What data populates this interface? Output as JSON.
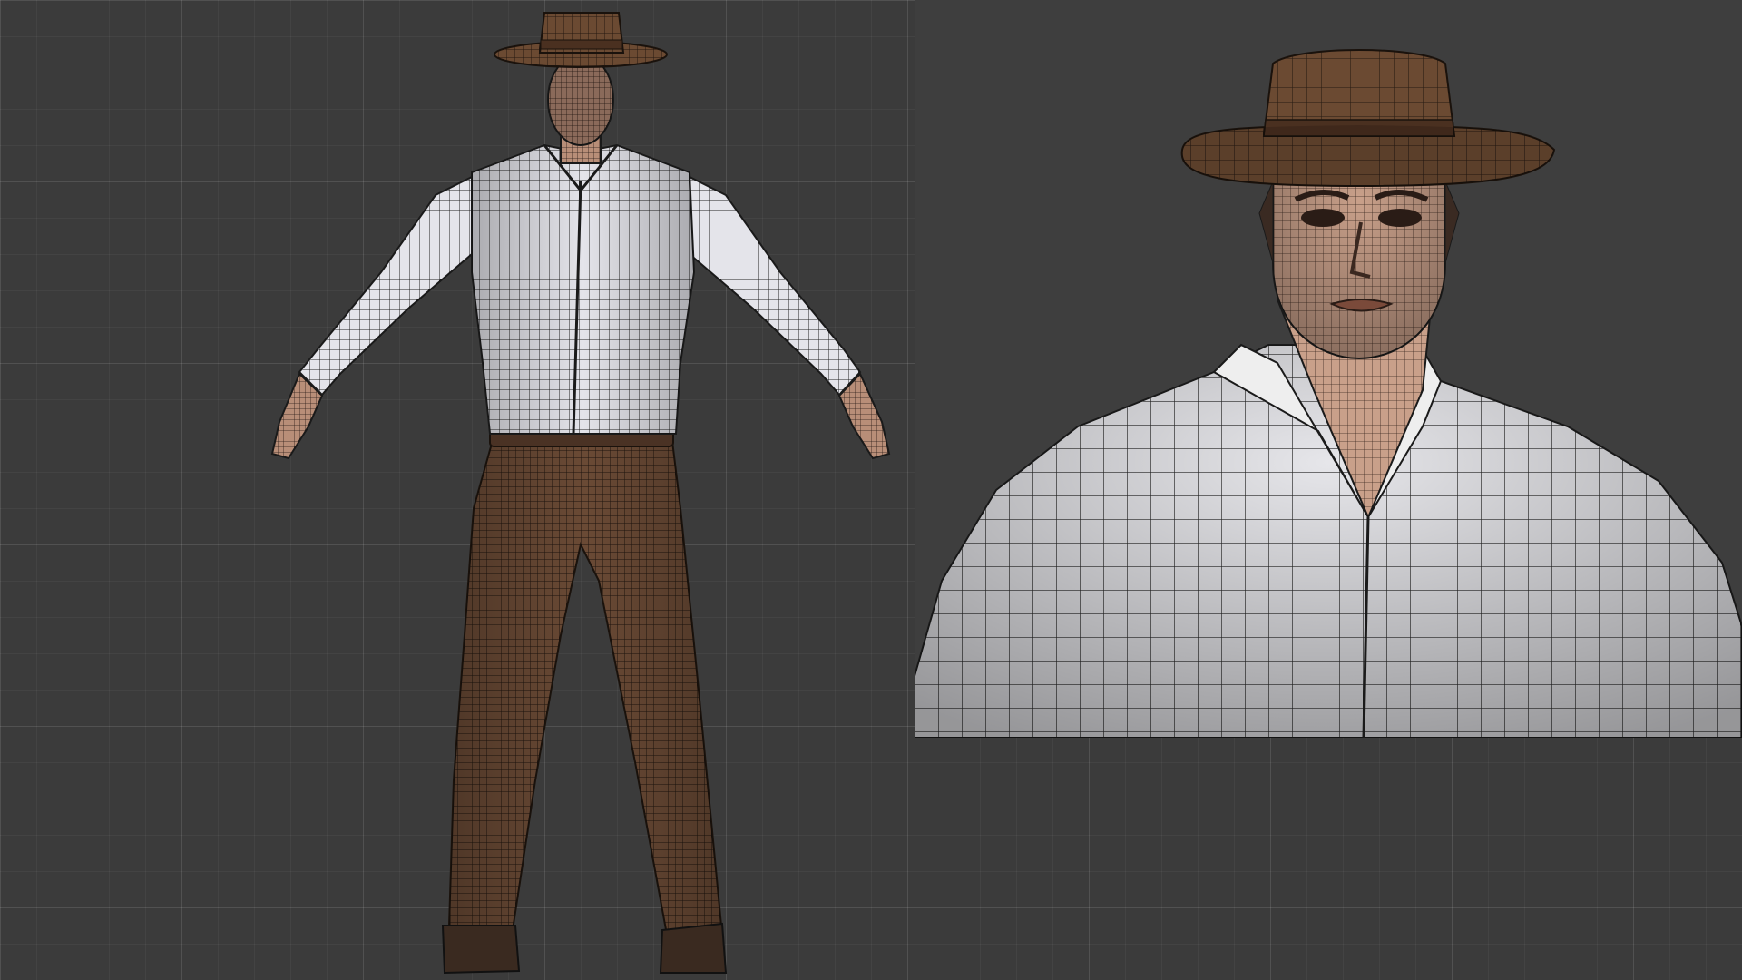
{
  "scene": {
    "background_color": "#3b3b3b",
    "grid_color": "#454545",
    "views": [
      {
        "name": "full-body-front-view",
        "subject": "character-t-pose-wireframe"
      },
      {
        "name": "closeup-head-torso-view",
        "subject": "character-bust-wireframe"
      }
    ]
  },
  "materials": {
    "hat": "#6b4a32",
    "hat_band": "#4a3020",
    "shirt": "#e6e6ea",
    "pants": "#6a4a35",
    "skin": "#c9a08a",
    "belt": "#4a3224",
    "shoes": "#3a2a20",
    "wire": "#1a1a1a"
  }
}
